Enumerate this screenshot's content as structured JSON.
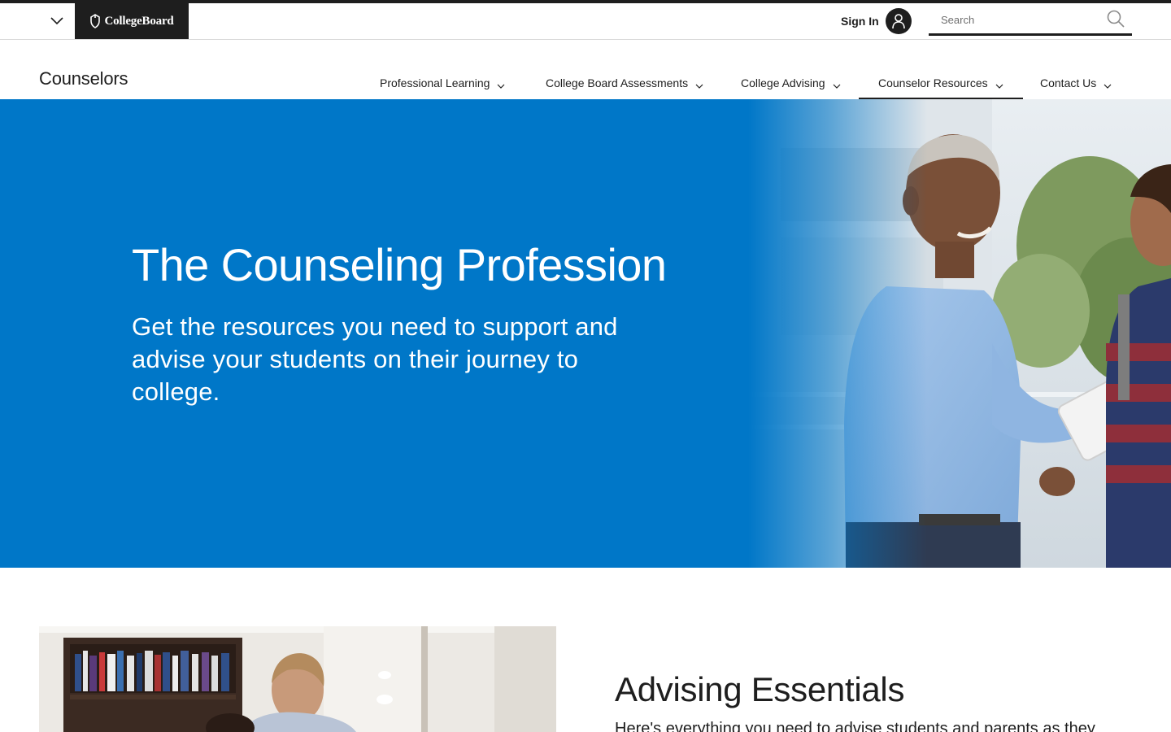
{
  "global_header": {
    "brand": "CollegeBoard",
    "sign_in_label": "Sign In",
    "search": {
      "placeholder": "Search",
      "value": ""
    }
  },
  "local_nav": {
    "site_title": "Counselors",
    "items": [
      {
        "label": "Professional Learning"
      },
      {
        "label": "College Board Assessments"
      },
      {
        "label": "College Advising"
      },
      {
        "label": "Counselor Resources",
        "active": true
      },
      {
        "label": "Contact Us"
      }
    ]
  },
  "hero": {
    "title": "The Counseling Profession",
    "subtitle": "Get the resources you need to support and advise your students on their journey to college.",
    "background_color": "#0077c8"
  },
  "section": {
    "title": "Advising Essentials",
    "text": "Here's everything you need to advise students and parents as they"
  },
  "colors": {
    "brand_black": "#1e1e1e",
    "hero_blue": "#0077c8"
  }
}
